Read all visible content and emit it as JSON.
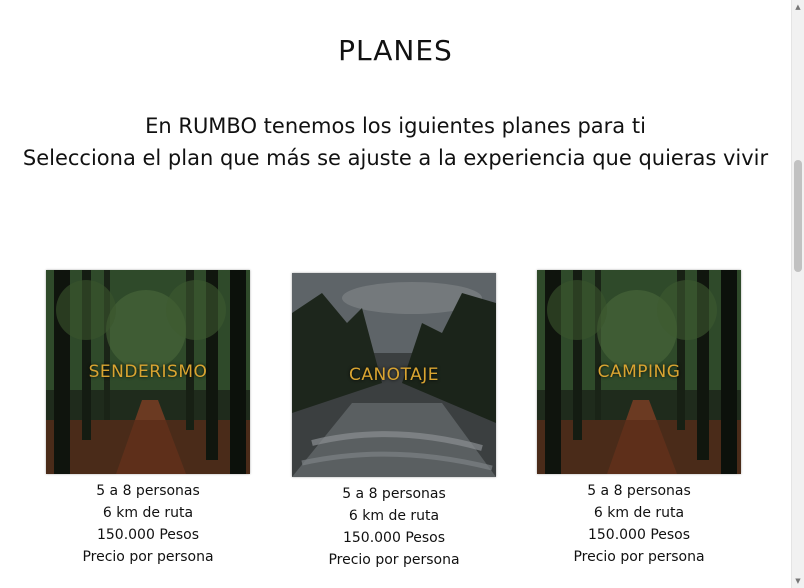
{
  "heading": "PLANES",
  "intro": {
    "line1": "En RUMBO tenemos los iguientes planes para ti",
    "line2": "Selecciona el plan que más se ajuste a la experiencia que quieras vivir"
  },
  "accent_color": "#d9a431",
  "plans": [
    {
      "name": "SENDERISMO",
      "people": "5 a 8 personas",
      "route": "6 km de ruta",
      "price": "150.000 Pesos",
      "price_note": "Precio por persona"
    },
    {
      "name": "CANOTAJE",
      "people": "5 a 8 personas",
      "route": "6 km de ruta",
      "price": "150.000 Pesos",
      "price_note": "Precio por persona"
    },
    {
      "name": "CAMPING",
      "people": "5 a 8 personas",
      "route": "6 km de ruta",
      "price": "150.000 Pesos",
      "price_note": "Precio por persona"
    }
  ]
}
